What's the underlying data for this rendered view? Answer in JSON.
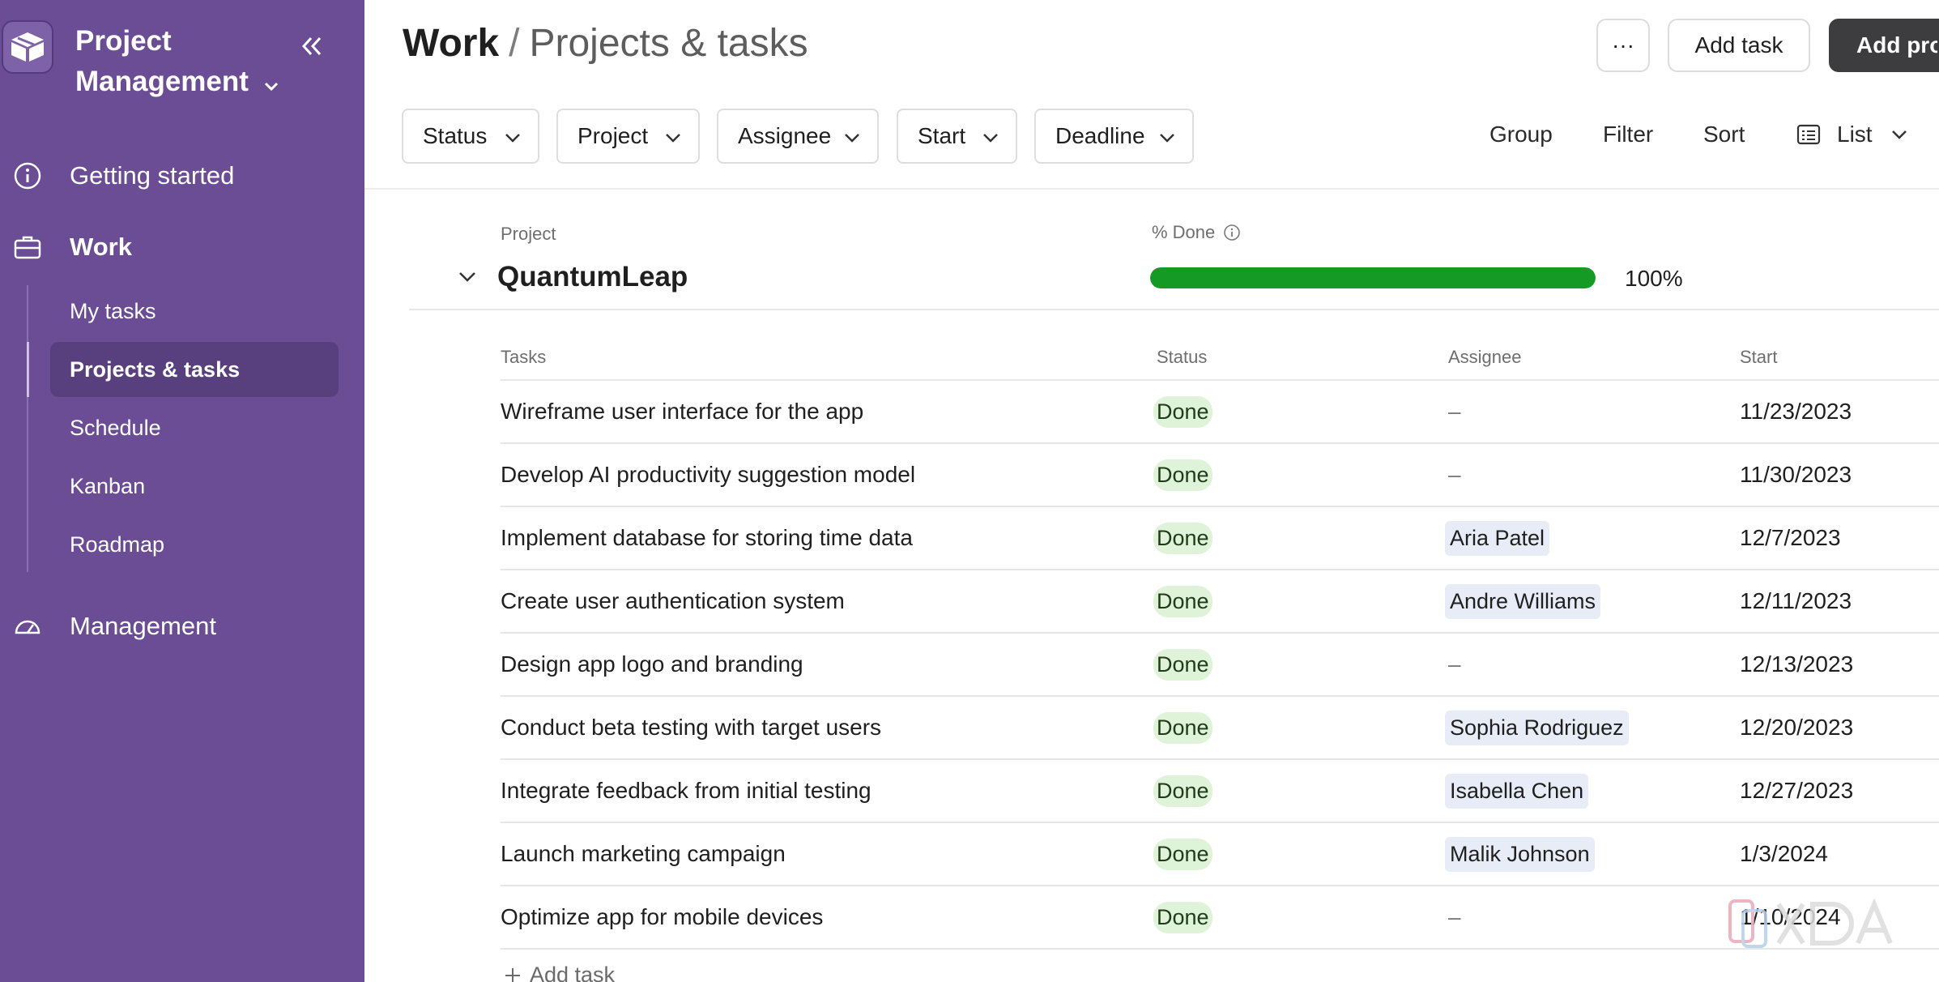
{
  "sidebar": {
    "workspace_title": "Project Management",
    "nav": {
      "getting_started": "Getting started",
      "work": "Work",
      "management": "Management"
    },
    "work_items": [
      "My tasks",
      "Projects & tasks",
      "Schedule",
      "Kanban",
      "Roadmap"
    ],
    "active_item": "Projects & tasks"
  },
  "header": {
    "breadcrumb_root": "Work",
    "breadcrumb_sep": "/",
    "breadcrumb_current": "Projects & tasks",
    "more_label": "···",
    "add_task_label": "Add task",
    "add_project_label": "Add project"
  },
  "filters": [
    "Status",
    "Project",
    "Assignee",
    "Start",
    "Deadline"
  ],
  "toolbar": {
    "group": "Group",
    "filter": "Filter",
    "sort": "Sort",
    "view": "List"
  },
  "project_group": {
    "project_label": "Project",
    "name": "QuantumLeap",
    "pct_done_label": "% Done",
    "pct_done_value": 1.0,
    "pct_done_text": "100%"
  },
  "table": {
    "columns": [
      "Tasks",
      "Status",
      "Assignee",
      "Start"
    ],
    "rows": [
      {
        "task": "Wireframe user interface for the app",
        "status": "Done",
        "assignee": "–",
        "start": "11/23/2023"
      },
      {
        "task": "Develop AI productivity suggestion model",
        "status": "Done",
        "assignee": "–",
        "start": "11/30/2023"
      },
      {
        "task": "Implement database for storing time data",
        "status": "Done",
        "assignee": "Aria Patel",
        "start": "12/7/2023"
      },
      {
        "task": "Create user authentication system",
        "status": "Done",
        "assignee": "Andre Williams",
        "start": "12/11/2023"
      },
      {
        "task": "Design app logo and branding",
        "status": "Done",
        "assignee": "–",
        "start": "12/13/2023"
      },
      {
        "task": "Conduct beta testing with target users",
        "status": "Done",
        "assignee": "Sophia Rodriguez",
        "start": "12/20/2023"
      },
      {
        "task": "Integrate feedback from initial testing",
        "status": "Done",
        "assignee": "Isabella Chen",
        "start": "12/27/2023"
      },
      {
        "task": "Launch marketing campaign",
        "status": "Done",
        "assignee": "Malik Johnson",
        "start": "1/3/2024"
      },
      {
        "task": "Optimize app for mobile devices",
        "status": "Done",
        "assignee": "–",
        "start": "1/10/2024"
      }
    ],
    "add_task_label": "Add task"
  },
  "watermark": "XDA",
  "colors": {
    "sidebar_bg": "#6a4d95",
    "sidebar_active": "#58407f",
    "progress": "#159a25",
    "done_pill": "#dff3d9",
    "assignee_pill": "#e7ecf6",
    "primary_button": "#3d3d40"
  }
}
